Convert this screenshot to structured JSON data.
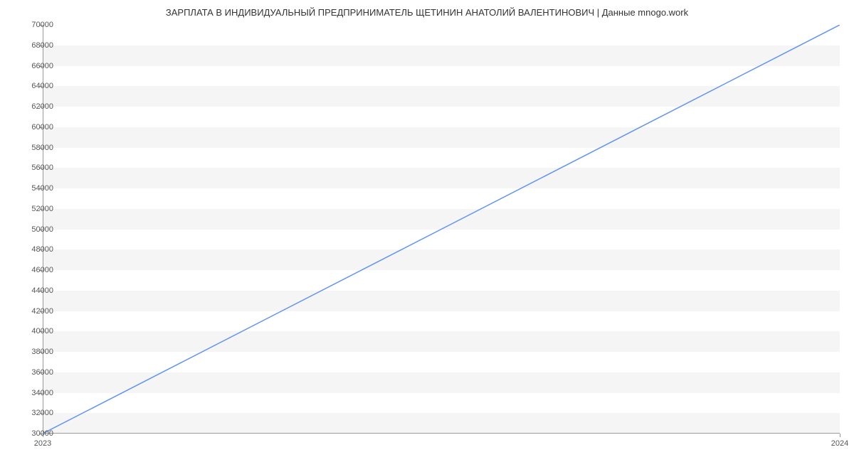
{
  "chart_data": {
    "type": "line",
    "title": "ЗАРПЛАТА В ИНДИВИДУАЛЬНЫЙ ПРЕДПРИНИМАТЕЛЬ ЩЕТИНИН АНАТОЛИЙ ВАЛЕНТИНОВИЧ | Данные mnogo.work",
    "x": [
      2023,
      2024
    ],
    "values": [
      30000,
      70000
    ],
    "xlabel": "",
    "ylabel": "",
    "xlim": [
      2023,
      2024
    ],
    "ylim": [
      30000,
      70000
    ],
    "y_ticks": [
      30000,
      32000,
      34000,
      36000,
      38000,
      40000,
      42000,
      44000,
      46000,
      48000,
      50000,
      52000,
      54000,
      56000,
      58000,
      60000,
      62000,
      64000,
      66000,
      68000,
      70000
    ],
    "x_ticks": [
      2023,
      2024
    ],
    "line_color": "#6495ED",
    "grid": true
  }
}
